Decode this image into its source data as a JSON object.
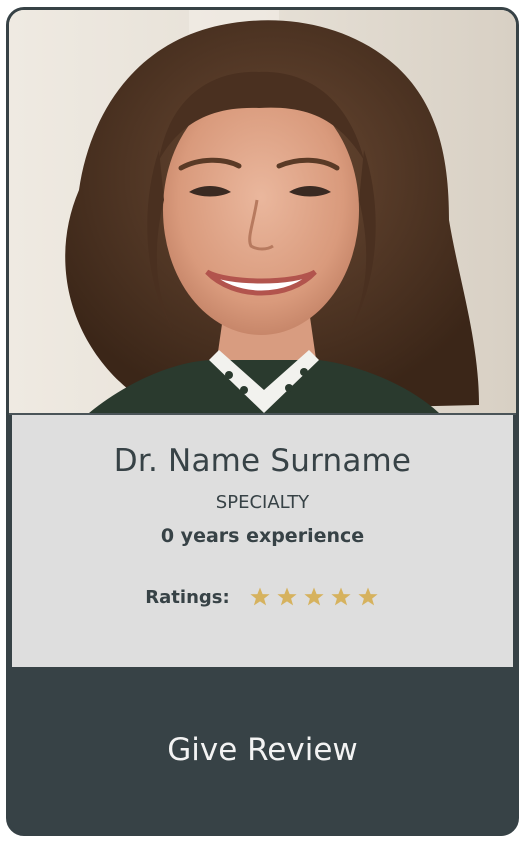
{
  "doctor": {
    "name": "Dr. Name Surname",
    "specialty": "SPECIALTY",
    "experience": "0 years experience",
    "photo_icon": "doctor-portrait-photo"
  },
  "ratings": {
    "label": "Ratings:",
    "stars": 5,
    "max_stars": 5,
    "star_icon": "star-icon",
    "star_color": "#d6b25e"
  },
  "action": {
    "review_label": "Give Review"
  },
  "colors": {
    "card_dark": "#374246",
    "info_background": "#dedede",
    "button_text": "#f3f3f3"
  }
}
